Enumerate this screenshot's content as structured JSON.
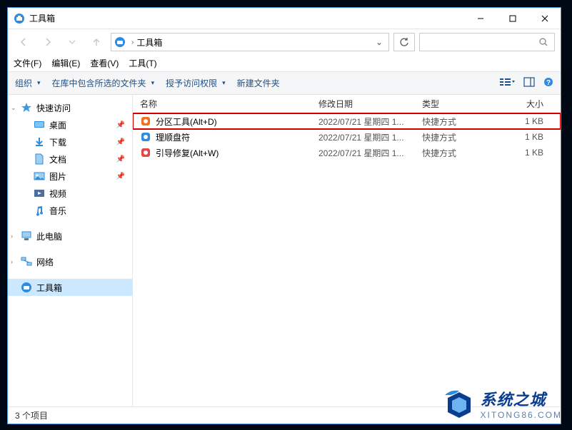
{
  "window": {
    "title": "工具箱"
  },
  "breadcrumb": {
    "location": "工具箱"
  },
  "menubar": {
    "file": "文件(F)",
    "edit": "编辑(E)",
    "view": "查看(V)",
    "tools": "工具(T)"
  },
  "toolbar": {
    "organize": "组织",
    "include": "在库中包含所选的文件夹",
    "grant": "授予访问权限",
    "newfolder": "新建文件夹"
  },
  "sidebar": {
    "quick": "快速访问",
    "desktop": "桌面",
    "downloads": "下载",
    "documents": "文档",
    "pictures": "图片",
    "videos": "视频",
    "music": "音乐",
    "thispc": "此电脑",
    "network": "网络",
    "toolbox": "工具箱"
  },
  "columns": {
    "name": "名称",
    "date": "修改日期",
    "type": "类型",
    "size": "大小"
  },
  "files": [
    {
      "name": "分区工具(Alt+D)",
      "date": "2022/07/21 星期四 1...",
      "type": "快捷方式",
      "size": "1 KB",
      "iconColor": "#f36f21"
    },
    {
      "name": "理顺盘符",
      "date": "2022/07/21 星期四 1...",
      "type": "快捷方式",
      "size": "1 KB",
      "iconColor": "#2e8bde"
    },
    {
      "name": "引导修复(Alt+W)",
      "date": "2022/07/21 星期四 1...",
      "type": "快捷方式",
      "size": "1 KB",
      "iconColor": "#e64545"
    }
  ],
  "status": {
    "count": "3 个项目"
  },
  "watermark": {
    "title": "系统之城",
    "url": "XITONG86.COM"
  }
}
